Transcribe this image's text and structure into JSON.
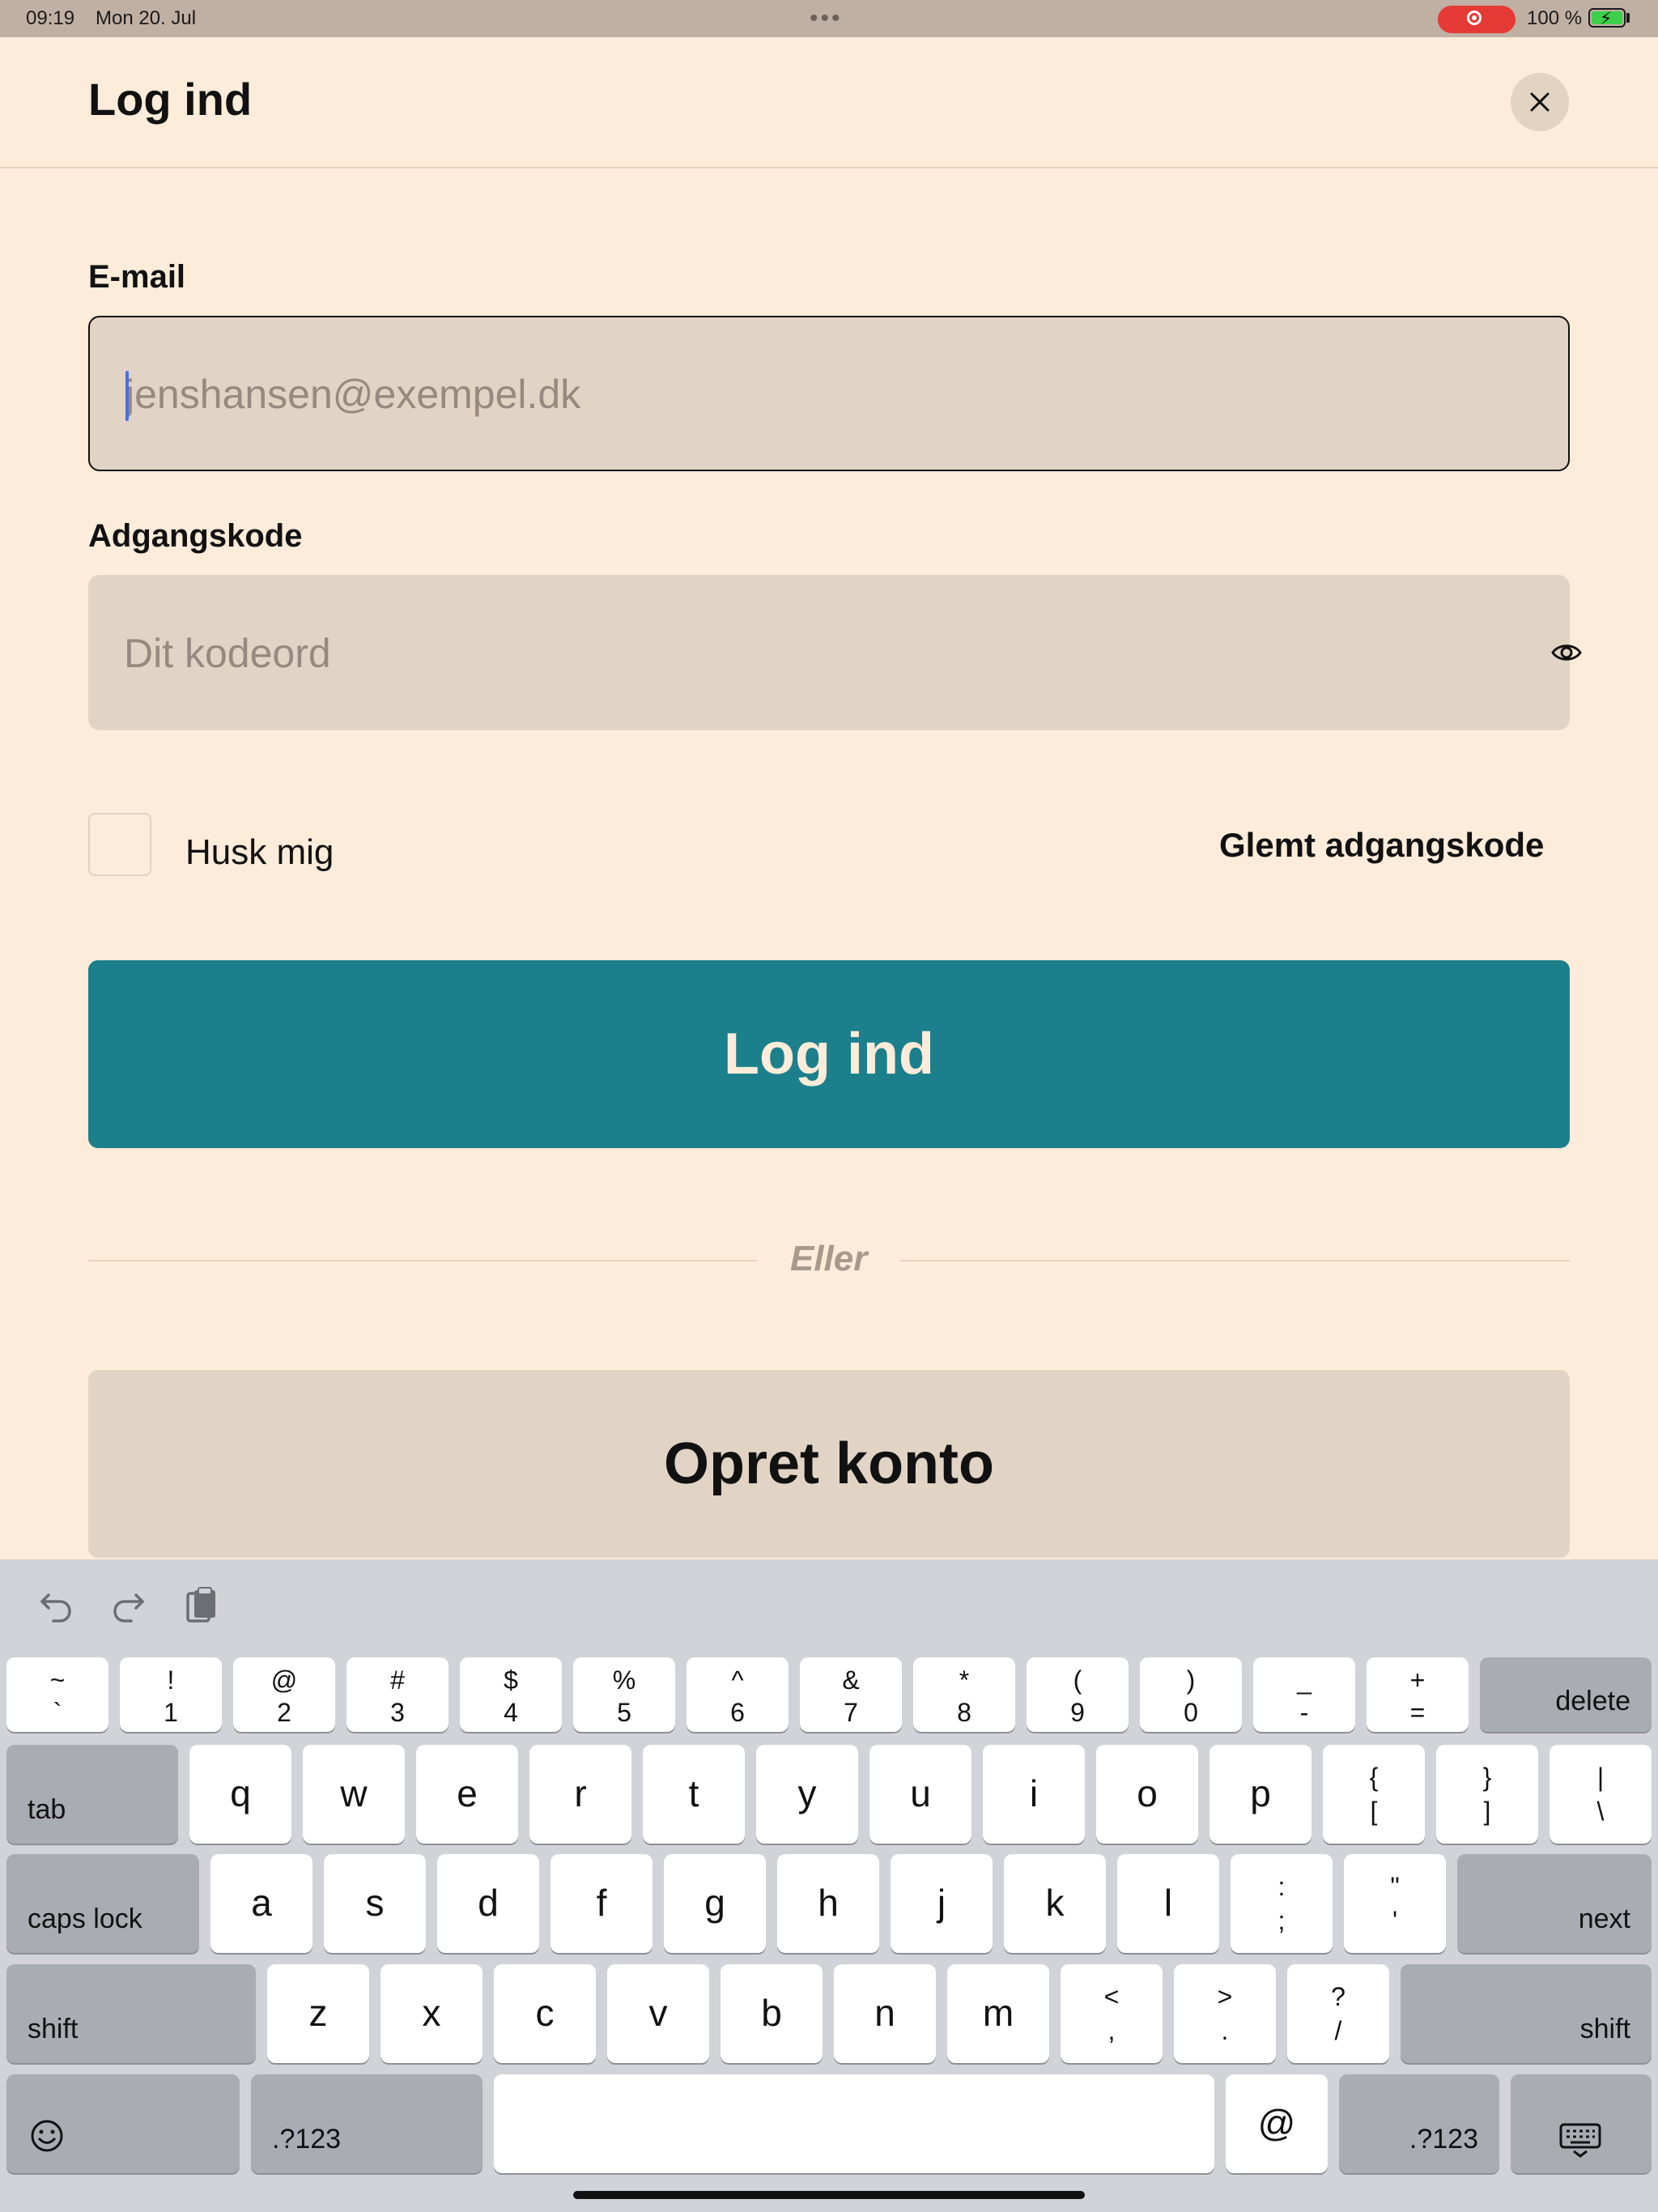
{
  "status_bar": {
    "time": "09:19",
    "date": "Mon 20. Jul",
    "battery_percent": "100 %",
    "recording": true,
    "battery_charging": true
  },
  "sheet": {
    "title": "Log ind",
    "close_icon": "close-icon"
  },
  "form": {
    "email_label": "E-mail",
    "email_value": "",
    "email_placeholder": "jenshansen@exempel.dk",
    "password_label": "Adgangskode",
    "password_value": "",
    "password_placeholder": "Dit kodeord",
    "password_toggle_icon": "eye-icon",
    "remember_label": "Husk mig",
    "remember_checked": false,
    "forgot_label": "Glemt adgangskode",
    "login_button": "Log ind",
    "or_label": "Eller",
    "create_button": "Opret konto"
  },
  "colors": {
    "background": "#fdecd9",
    "primary": "#1b808b",
    "field": "#e2d4c4",
    "caret": "#4a6fe0"
  },
  "keyboard": {
    "toolbar": [
      "undo-icon",
      "redo-icon",
      "paste-icon"
    ],
    "number_row": [
      {
        "top": "~",
        "bottom": "`"
      },
      {
        "top": "!",
        "bottom": "1"
      },
      {
        "top": "@",
        "bottom": "2"
      },
      {
        "top": "#",
        "bottom": "3"
      },
      {
        "top": "$",
        "bottom": "4"
      },
      {
        "top": "%",
        "bottom": "5"
      },
      {
        "top": "^",
        "bottom": "6"
      },
      {
        "top": "&",
        "bottom": "7"
      },
      {
        "top": "*",
        "bottom": "8"
      },
      {
        "top": "(",
        "bottom": "9"
      },
      {
        "top": ")",
        "bottom": "0"
      },
      {
        "top": "_",
        "bottom": "-"
      },
      {
        "top": "+",
        "bottom": "="
      }
    ],
    "delete": "delete",
    "tab": "tab",
    "row_q": [
      "q",
      "w",
      "e",
      "r",
      "t",
      "y",
      "u",
      "i",
      "o",
      "p"
    ],
    "row_q_symbols": [
      {
        "top": "{",
        "bottom": "["
      },
      {
        "top": "}",
        "bottom": "]"
      },
      {
        "top": "|",
        "bottom": "\\"
      }
    ],
    "caps_lock": "caps lock",
    "row_a": [
      "a",
      "s",
      "d",
      "f",
      "g",
      "h",
      "j",
      "k",
      "l"
    ],
    "row_a_symbols": [
      {
        "top": ":",
        "bottom": ";"
      },
      {
        "top": "\"",
        "bottom": "'"
      }
    ],
    "next": "next",
    "shift": "shift",
    "row_z": [
      "z",
      "x",
      "c",
      "v",
      "b",
      "n",
      "m"
    ],
    "row_z_symbols": [
      {
        "top": "<",
        "bottom": ","
      },
      {
        "top": ">",
        "bottom": "."
      },
      {
        "top": "?",
        "bottom": "/"
      }
    ],
    "emoji_icon": "emoji-icon",
    "numbers_label": ".?123",
    "at_key": "@",
    "dismiss_icon": "keyboard-dismiss-icon"
  }
}
